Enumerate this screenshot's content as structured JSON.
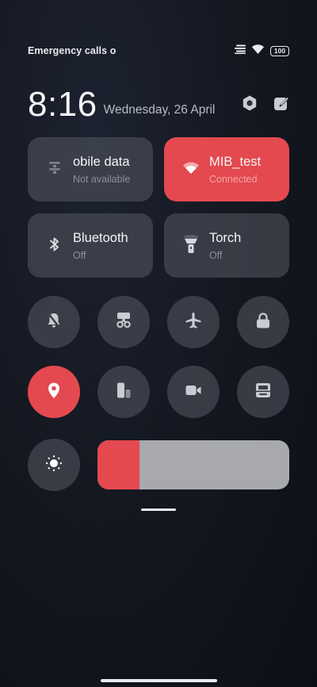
{
  "status_bar": {
    "carrier": "Emergency calls o",
    "icons": [
      "data-signal-icon",
      "wifi-icon",
      "battery-icon"
    ],
    "battery": "100"
  },
  "clock": {
    "time": "8:16",
    "date": "Wednesday, 26 April",
    "actions": [
      "settings-icon",
      "edit-icon"
    ]
  },
  "tiles": {
    "mobile_data": {
      "title": "obile data",
      "subtitle": "Not available",
      "icon": "mobile-data-icon",
      "active": false
    },
    "wifi": {
      "title": "MIB_test",
      "subtitle": "Connected",
      "icon": "wifi-icon",
      "active": true
    },
    "bluetooth": {
      "title": "Bluetooth",
      "subtitle": "Off",
      "icon": "bluetooth-icon",
      "active": false
    },
    "torch": {
      "title": "Torch",
      "subtitle": "Off",
      "icon": "torch-icon",
      "active": false
    }
  },
  "toggles_row1": [
    "silent-mode-icon",
    "screenshot-icon",
    "airplane-mode-icon",
    "lock-screen-icon"
  ],
  "toggles_row2": [
    "location-icon",
    "split-screen-icon",
    "screen-recorder-icon",
    "reading-mode-icon"
  ],
  "brightness": {
    "icon": "brightness-icon",
    "level": 0.22
  },
  "colors": {
    "accent": "#e3494f",
    "tile": "#4e525c",
    "slider_track": "#a7a9ad"
  }
}
